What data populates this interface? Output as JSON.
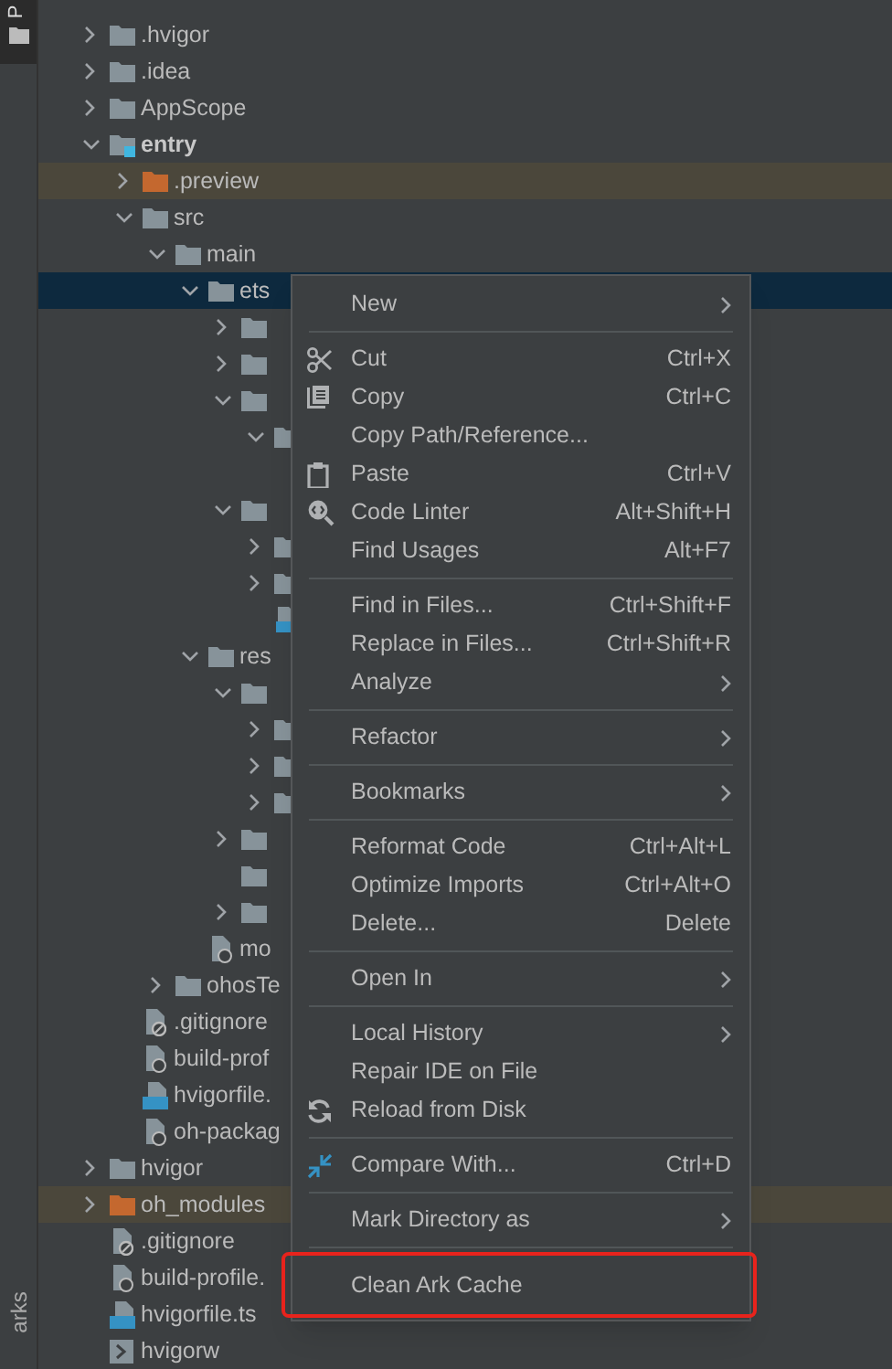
{
  "side_strip": {
    "top_tab": "P",
    "bottom_tab": "arks"
  },
  "tree": [
    {
      "label": ".hvigor",
      "kind": "folder",
      "expanded": false
    },
    {
      "label": ".idea",
      "kind": "folder",
      "expanded": false
    },
    {
      "label": "AppScope",
      "kind": "folder",
      "expanded": false
    },
    {
      "label": "entry",
      "kind": "module",
      "expanded": true,
      "children": [
        {
          "label": ".preview",
          "kind": "excluded",
          "expanded": false,
          "highlighted": true
        },
        {
          "label": "src",
          "kind": "folder",
          "expanded": true,
          "children": [
            {
              "label": "main",
              "kind": "folder",
              "expanded": true,
              "children": [
                {
                  "label": "ets",
                  "kind": "folder",
                  "expanded": true,
                  "selected": true,
                  "children": [
                    {
                      "kind": "folder",
                      "expanded": false
                    },
                    {
                      "kind": "folder",
                      "expanded": false
                    },
                    {
                      "kind": "folder",
                      "expanded": true,
                      "children": [
                        {
                          "kind": "folder",
                          "expanded": true
                        }
                      ]
                    },
                    {
                      "kind": "folder",
                      "expanded": true,
                      "children": [
                        {
                          "kind": "folder",
                          "expanded": false
                        },
                        {
                          "kind": "folder",
                          "expanded": false
                        },
                        {
                          "kind": "file-ets"
                        }
                      ]
                    }
                  ]
                },
                {
                  "label": "res",
                  "kind": "folder",
                  "expanded": true,
                  "children": [
                    {
                      "kind": "folder",
                      "expanded": true,
                      "children": [
                        {
                          "kind": "folder",
                          "expanded": false
                        },
                        {
                          "kind": "folder",
                          "expanded": false
                        },
                        {
                          "kind": "folder",
                          "expanded": false
                        }
                      ]
                    },
                    {
                      "kind": "folder",
                      "expanded": false
                    },
                    {
                      "kind": "folder"
                    },
                    {
                      "kind": "folder",
                      "expanded": false
                    }
                  ]
                },
                {
                  "label": "mo",
                  "kind": "file-json"
                }
              ]
            },
            {
              "label": "ohosTe",
              "kind": "folder",
              "expanded": false
            }
          ]
        },
        {
          "label": ".gitignore",
          "kind": "file-gitignore"
        },
        {
          "label": "build-prof",
          "kind": "file-json"
        },
        {
          "label": "hvigorfile.",
          "kind": "file-ts"
        },
        {
          "label": "oh-packag",
          "kind": "file-json"
        }
      ]
    },
    {
      "label": "hvigor",
      "kind": "folder",
      "expanded": false
    },
    {
      "label": "oh_modules",
      "kind": "excluded",
      "expanded": false,
      "highlighted": true
    },
    {
      "label": ".gitignore",
      "kind": "file-gitignore"
    },
    {
      "label": "build-profile.",
      "kind": "file-json"
    },
    {
      "label": "hvigorfile.ts",
      "kind": "file-ts"
    },
    {
      "label": "hvigorw",
      "kind": "file-script"
    }
  ],
  "context_menu": [
    [
      {
        "label": "New",
        "submenu": true
      }
    ],
    [
      {
        "label": "Cut",
        "shortcut": "Ctrl+X",
        "kind": "cut"
      },
      {
        "label": "Copy",
        "shortcut": "Ctrl+C",
        "kind": "copy"
      },
      {
        "label": "Copy Path/Reference..."
      },
      {
        "label": "Paste",
        "shortcut": "Ctrl+V",
        "kind": "paste"
      },
      {
        "label": "Code Linter",
        "shortcut": "Alt+Shift+H",
        "kind": "linter"
      },
      {
        "label": "Find Usages",
        "shortcut": "Alt+F7"
      }
    ],
    [
      {
        "label": "Find in Files...",
        "shortcut": "Ctrl+Shift+F"
      },
      {
        "label": "Replace in Files...",
        "shortcut": "Ctrl+Shift+R"
      },
      {
        "label": "Analyze",
        "submenu": true
      }
    ],
    [
      {
        "label": "Refactor",
        "submenu": true
      }
    ],
    [
      {
        "label": "Bookmarks",
        "submenu": true
      }
    ],
    [
      {
        "label": "Reformat Code",
        "shortcut": "Ctrl+Alt+L"
      },
      {
        "label": "Optimize Imports",
        "shortcut": "Ctrl+Alt+O"
      },
      {
        "label": "Delete...",
        "shortcut": "Delete"
      }
    ],
    [
      {
        "label": "Open In",
        "submenu": true
      }
    ],
    [
      {
        "label": "Local History",
        "submenu": true
      },
      {
        "label": "Repair IDE on File"
      },
      {
        "label": "Reload from Disk",
        "kind": "reload"
      }
    ],
    [
      {
        "label": "Compare With...",
        "shortcut": "Ctrl+D",
        "kind": "compare"
      }
    ],
    [
      {
        "label": "Mark Directory as",
        "submenu": true
      }
    ],
    [
      {
        "label": "Clean Ark Cache",
        "highlighted": true
      }
    ]
  ]
}
